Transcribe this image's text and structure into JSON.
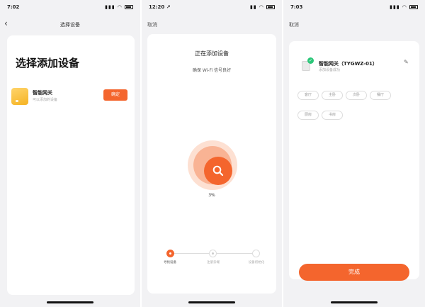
{
  "colors": {
    "accent": "#f4652d",
    "success": "#2cc779",
    "background": "#f2f2f4"
  },
  "screen1": {
    "status_time": "7:02",
    "nav_title": "选择设备",
    "heading": "选择添加设备",
    "device": {
      "name": "智能网关",
      "subtitle": "可以添加的设备",
      "button_label": "确定",
      "icon": "gateway-icon"
    }
  },
  "screen2": {
    "status_time": "12:20 ↗",
    "cancel_label": "取消",
    "title": "正在添加设备",
    "subtitle": "确保 Wi-Fi 信号良好",
    "progress_text": "3%",
    "progress_value": 0.03,
    "steps": [
      {
        "label": "寻找设备"
      },
      {
        "label": "注册云端"
      },
      {
        "label": "设备初始化"
      }
    ],
    "active_step": 0
  },
  "screen3": {
    "status_time": "7:03",
    "cancel_label": "取消",
    "device_name": "智能网关（TYGWZ-01）",
    "device_status": "添加设备成功",
    "rooms": [
      "客厅",
      "主卧",
      "次卧",
      "餐厅",
      "厨房",
      "书房"
    ],
    "done_label": "完成"
  }
}
